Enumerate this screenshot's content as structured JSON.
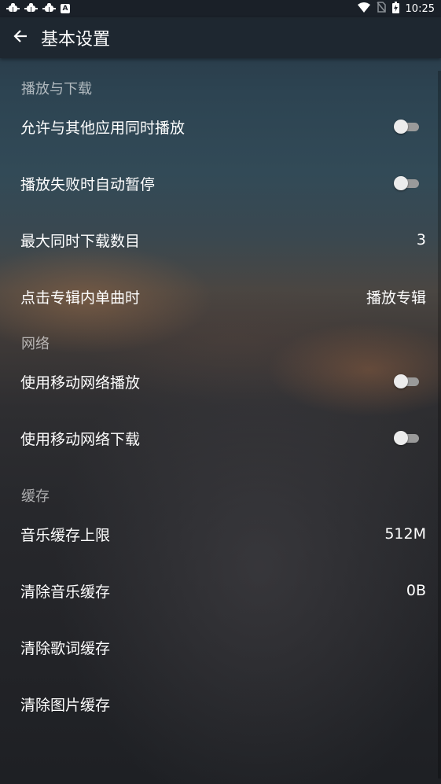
{
  "status_bar": {
    "time": "10:25",
    "notification_icons": [
      "bug-icon",
      "bug-icon",
      "bug-icon",
      "a-icon"
    ],
    "a_icon_letter": "A",
    "right_icons": [
      "wifi-icon",
      "no-sim-icon",
      "battery-charging-icon"
    ]
  },
  "app_bar": {
    "title": "基本设置",
    "back_icon": "arrow-left-icon"
  },
  "sections": {
    "playback": {
      "header": "播放与下载",
      "items": {
        "allow_concurrent": {
          "label": "允许与其他应用同时播放",
          "switch_on": false
        },
        "pause_on_fail": {
          "label": "播放失败时自动暂停",
          "switch_on": false
        },
        "max_downloads": {
          "label": "最大同时下载数目",
          "value": "3"
        },
        "album_click": {
          "label": "点击专辑内单曲时",
          "value": "播放专辑"
        }
      }
    },
    "network": {
      "header": "网络",
      "items": {
        "mobile_play": {
          "label": "使用移动网络播放",
          "switch_on": false
        },
        "mobile_download": {
          "label": "使用移动网络下载",
          "switch_on": false
        }
      }
    },
    "cache": {
      "header": "缓存",
      "items": {
        "music_cache_limit": {
          "label": "音乐缓存上限",
          "value": "512M"
        },
        "clear_music_cache": {
          "label": "清除音乐缓存",
          "value": "0B"
        },
        "clear_lyrics_cache": {
          "label": "清除歌词缓存"
        },
        "clear_image_cache": {
          "label": "清除图片缓存"
        }
      }
    }
  },
  "colors": {
    "app_bar_bg": "#1e262f",
    "status_bar_bg": "#1a2028",
    "text_primary": "#ffffff",
    "text_header": "#a8acb0",
    "switch_track_off": "#9a9a9a",
    "switch_thumb_off": "#ececec"
  }
}
